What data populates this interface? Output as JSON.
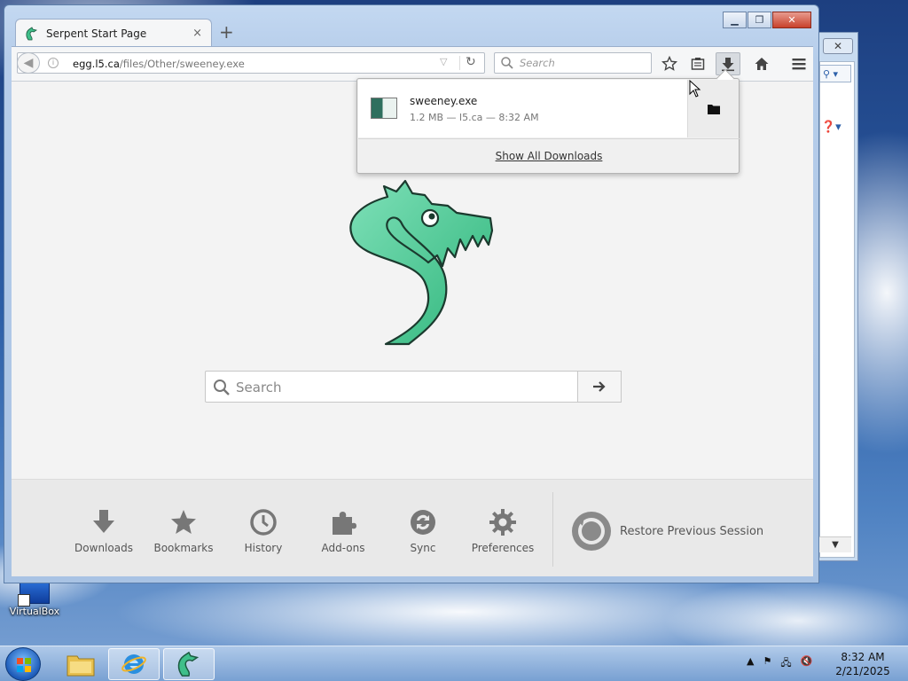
{
  "browser": {
    "tab_title": "Serpent Start Page",
    "tab_close": "×",
    "new_tab": "+",
    "url_host": "egg.l5.ca",
    "url_path": "/files/Other/sweeney.exe",
    "search_placeholder": "Search"
  },
  "downloads_panel": {
    "file_name": "sweeney.exe",
    "file_meta": "1.2 MB — l5.ca — 8:32 AM",
    "show_all": "Show All Downloads"
  },
  "start_page": {
    "search_placeholder": "Search",
    "launcher": [
      {
        "label": "Downloads",
        "icon": "download-icon"
      },
      {
        "label": "Bookmarks",
        "icon": "bookmarks-icon"
      },
      {
        "label": "History",
        "icon": "history-icon"
      },
      {
        "label": "Add-ons",
        "icon": "addons-icon"
      },
      {
        "label": "Sync",
        "icon": "sync-icon"
      },
      {
        "label": "Preferences",
        "icon": "preferences-icon"
      }
    ],
    "restore_label": "Restore Previous Session"
  },
  "desktop": {
    "icon_label": "VirtualBox"
  },
  "taskbar": {
    "time": "8:32 AM",
    "date": "2/21/2025"
  },
  "colors": {
    "accent": "#3fbf8a",
    "window_frame": "#b6cdea"
  }
}
